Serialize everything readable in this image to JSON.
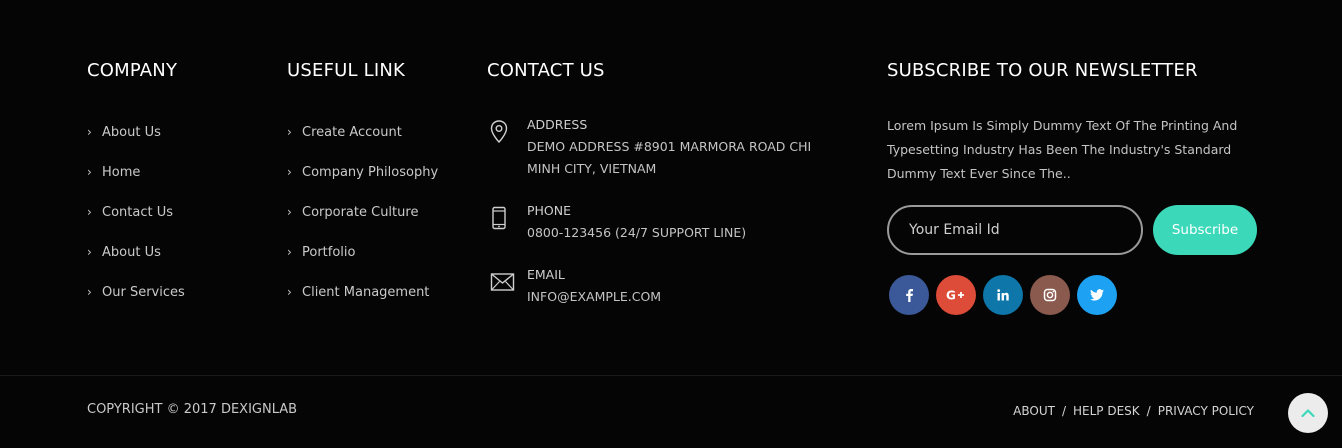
{
  "company": {
    "heading": "COMPANY",
    "items": [
      {
        "label": "About Us"
      },
      {
        "label": "Home"
      },
      {
        "label": "Contact Us"
      },
      {
        "label": "About Us"
      },
      {
        "label": "Our Services"
      }
    ]
  },
  "useful": {
    "heading": "USEFUL LINK",
    "items": [
      {
        "label": "Create Account"
      },
      {
        "label": "Company Philosophy"
      },
      {
        "label": "Corporate Culture"
      },
      {
        "label": "Portfolio"
      },
      {
        "label": "Client Management"
      }
    ]
  },
  "contact": {
    "heading": "CONTACT US",
    "address": {
      "title": "ADDRESS",
      "value": "DEMO ADDRESS #8901 MARMORA ROAD CHI MINH CITY, VIETNAM",
      "icon": "map-pin-icon"
    },
    "phone": {
      "title": "PHONE",
      "value": "0800-123456 (24/7 SUPPORT LINE)",
      "icon": "mobile-phone-icon"
    },
    "email": {
      "title": "EMAIL",
      "value": "INFO@EXAMPLE.COM",
      "icon": "envelope-icon"
    }
  },
  "newsletter": {
    "heading": "SUBSCRIBE TO OUR NEWSLETTER",
    "text": "Lorem Ipsum Is Simply Dummy Text Of The Printing And Typesetting Industry Has Been The Industry's Standard Dummy Text Ever Since The..",
    "email_placeholder": "Your Email Id",
    "subscribe_label": "Subscribe",
    "accent": "#3bd9b9"
  },
  "socials": [
    {
      "name": "facebook-icon",
      "glyph": "f",
      "color": "#3b5998"
    },
    {
      "name": "google-plus-icon",
      "glyph": "G+",
      "color": "#dd4b39"
    },
    {
      "name": "linkedin-icon",
      "glyph": "in",
      "color": "#0e76a8"
    },
    {
      "name": "instagram-icon",
      "glyph": "◎",
      "color": "#8a5a4e"
    },
    {
      "name": "twitter-icon",
      "glyph": "🐦",
      "color": "#1da1f2"
    }
  ],
  "bottom": {
    "copyright": "COPYRIGHT © 2017 DEXIGNLAB",
    "links": [
      {
        "label": "ABOUT"
      },
      {
        "label": "HELP DESK"
      },
      {
        "label": "PRIVACY POLICY"
      }
    ],
    "separator": "/"
  },
  "back_to_top": {
    "icon": "chevron-up-icon",
    "color": "#3bd9b9"
  }
}
